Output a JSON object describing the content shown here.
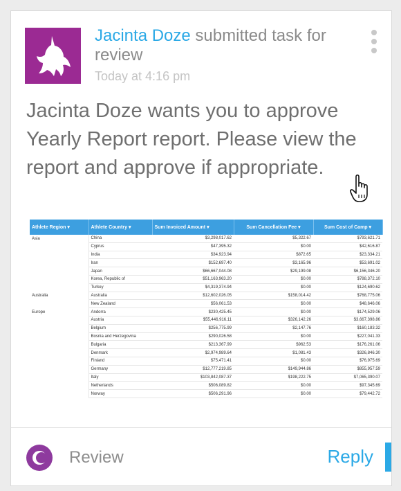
{
  "header": {
    "user_name": "Jacinta Doze",
    "action": " submitted task for review",
    "timestamp": "Today at 4:16 pm"
  },
  "message": "Jacinta Doze wants you to approve Yearly Report report. Please view the report and approve if appropriate.",
  "table": {
    "columns": [
      "Athlete Region",
      "Athlete Country",
      "Sum Invoiced Amount",
      "Sum Cancellation Fee",
      "Sum Cost of Camp"
    ],
    "rows": [
      [
        "Asia",
        "China",
        "$3,298,017.62",
        "$5,322.67",
        "$793,621.71"
      ],
      [
        "",
        "Cyprus",
        "$47,395.32",
        "$0.00",
        "$42,616.87"
      ],
      [
        "",
        "India",
        "$34,923.94",
        "$872.65",
        "$23,334.21"
      ],
      [
        "",
        "Iran",
        "$152,697.40",
        "$3,165.96",
        "$53,691.02"
      ],
      [
        "",
        "Japan",
        "$66,667,044.08",
        "$29,199.08",
        "$6,156,346.20"
      ],
      [
        "",
        "Korea, Republic of",
        "$51,163,963.20",
        "$0.00",
        "$788,372.10"
      ],
      [
        "",
        "Turkey",
        "$4,319,374.94",
        "$0.00",
        "$124,690.62"
      ],
      [
        "Australia",
        "Australia",
        "$12,602,026.05",
        "$158,014.42",
        "$768,775.06"
      ],
      [
        "",
        "New Zealand",
        "$56,061.53",
        "$0.00",
        "$48,646.06"
      ],
      [
        "Europe",
        "Andorra",
        "$230,425.45",
        "$0.00",
        "$174,529.06"
      ],
      [
        "",
        "Austria",
        "$55,446,916.11",
        "$326,142.26",
        "$3,667,398.86"
      ],
      [
        "",
        "Belgium",
        "$256,775.99",
        "$2,147.76",
        "$160,183.32"
      ],
      [
        "",
        "Bosnia and Herzegovina",
        "$290,026.58",
        "$0.00",
        "$227,041.33"
      ],
      [
        "",
        "Bulgaria",
        "$213,367.99",
        "$962.53",
        "$176,261.06"
      ],
      [
        "",
        "Denmark",
        "$2,974,989.64",
        "$1,081.43",
        "$326,846.30"
      ],
      [
        "",
        "Finland",
        "$75,471.41",
        "$0.00",
        "$76,975.69"
      ],
      [
        "",
        "Germany",
        "$12,777,219.85",
        "$149,944.86",
        "$855,957.59"
      ],
      [
        "",
        "Italy",
        "$103,842,087.37",
        "$198,222.75",
        "$7,065,390.07"
      ],
      [
        "",
        "Netherlands",
        "$506,089.82",
        "$0.00",
        "$97,345.69"
      ],
      [
        "",
        "Norway",
        "$506,291.96",
        "$0.00",
        "$79,442.72"
      ]
    ]
  },
  "footer": {
    "review_label": "Review",
    "reply_label": "Reply"
  },
  "icons": {
    "avatar": "unicorn-icon",
    "menu": "more-vertical-icon",
    "cursor": "hand-pointer-icon",
    "review": "review-icon",
    "header_sort": "caret-down-icon"
  },
  "colors": {
    "accent": "#2ba9e6",
    "avatar_bg": "#9b2a93",
    "review_icon": "#8e3a9e",
    "table_header": "#3d9fe0"
  }
}
